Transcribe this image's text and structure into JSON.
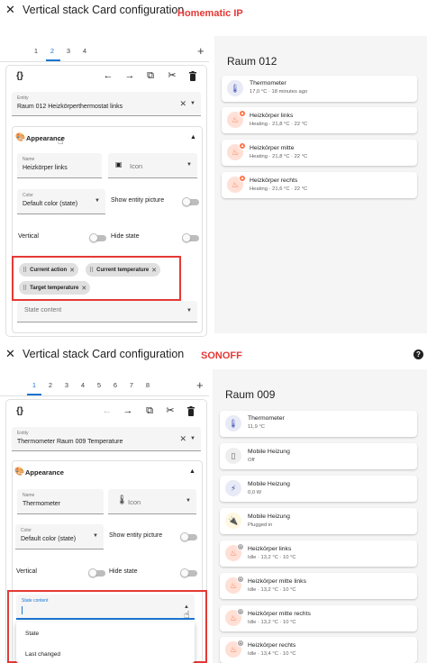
{
  "top": {
    "dialog_title": "Vertical stack Card configuration",
    "brand_label": "Homematic IP",
    "tabs": [
      "1",
      "2",
      "3",
      "4"
    ],
    "active_tab": "2",
    "entity_label": "Entity",
    "entity_value": "Raum 012 Heizkörperthermostat links",
    "appearance_title": "Appearance",
    "name_label": "Name",
    "name_value": "Heizkörper links",
    "icon_placeholder": "Icon",
    "color_label": "Color",
    "color_value": "Default color (state)",
    "show_entity_picture_label": "Show entity picture",
    "vertical_label": "Vertical",
    "hide_state_label": "Hide state",
    "state_chips": [
      "Current action",
      "Current temperature",
      "Target temperature"
    ],
    "state_content_placeholder": "State content",
    "preview": {
      "title": "Raum 012",
      "cards": [
        {
          "name": "Thermometer",
          "state": "17,0 °C · 18 minutes ago"
        },
        {
          "name": "Heizkörper links",
          "state": "Heating · 21,8 °C · 22 °C"
        },
        {
          "name": "Heizkörper mitte",
          "state": "Heating · 21,8 °C · 22 °C"
        },
        {
          "name": "Heizkörper rechts",
          "state": "Heating · 21,6 °C · 22 °C"
        }
      ]
    }
  },
  "bottom": {
    "dialog_title": "Vertical stack Card configuration",
    "brand_label": "SONOFF",
    "tabs": [
      "1",
      "2",
      "3",
      "4",
      "5",
      "6",
      "7",
      "8"
    ],
    "active_tab": "1",
    "entity_label": "Entity",
    "entity_value": "Thermometer Raum 009 Temperature",
    "appearance_title": "Appearance",
    "name_label": "Name",
    "name_value": "Thermometer",
    "icon_placeholder": "Icon",
    "color_label": "Color",
    "color_value": "Default color (state)",
    "show_entity_picture_label": "Show entity picture",
    "vertical_label": "Vertical",
    "hide_state_label": "Hide state",
    "state_content_label": "State content",
    "dropdown_options": [
      "State",
      "Last changed"
    ],
    "preview": {
      "title": "Raum 009",
      "cards": [
        {
          "name": "Thermometer",
          "state": "11,9 °C"
        },
        {
          "name": "Mobile Heizung",
          "state": "Off"
        },
        {
          "name": "Mobile Heizung",
          "state": "0,0 W"
        },
        {
          "name": "Mobile Heizung",
          "state": "Plugged in"
        },
        {
          "name": "Heizkörper links",
          "state": "Idle · 13,2 °C · 10 °C"
        },
        {
          "name": "Heizkörper mitte links",
          "state": "Idle · 13,2 °C · 10 °C"
        },
        {
          "name": "Heizkörper mitte rechts",
          "state": "Idle · 13,2 °C · 10 °C"
        },
        {
          "name": "Heizkörper rechts",
          "state": "Idle · 13,4 °C · 10 °C"
        }
      ]
    }
  },
  "colors": {
    "accent": "#1976d2",
    "highlight_red": "#e53935",
    "heating_orange": "#ff7043",
    "thermometer_blue": "#3f51b5",
    "plug_yellow": "#fbc02d"
  }
}
